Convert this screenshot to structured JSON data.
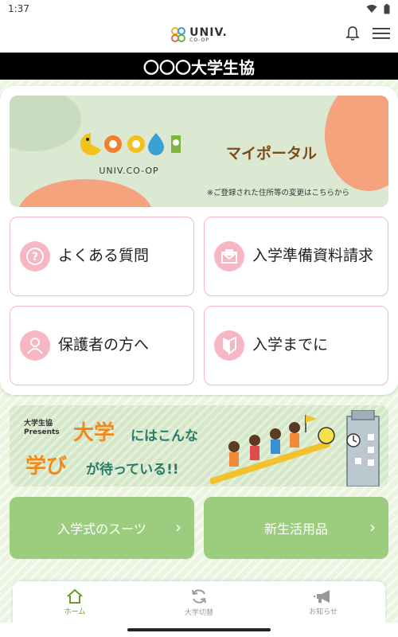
{
  "status": {
    "time": "1:37"
  },
  "header": {
    "logo_text": "UNIV.",
    "logo_sub": "CO-OP"
  },
  "title": "〇〇〇大学生協",
  "portal": {
    "logo_sub": "UNIV.CO-OP",
    "title": "マイポータル",
    "note": "※ご登録された住所等の変更はこちらから"
  },
  "tiles": [
    {
      "label": "よくある質問",
      "icon": "question-icon"
    },
    {
      "label": "入学準備資料請求",
      "icon": "mail-icon"
    },
    {
      "label": "保護者の方へ",
      "icon": "person-icon"
    },
    {
      "label": "入学までに",
      "icon": "beginner-mark-icon"
    }
  ],
  "banner": {
    "small1": "大学生協",
    "small2": "Presents",
    "big1": "大学",
    "mid1": "にはこんな",
    "big2": "学び",
    "mid2": "が待っている!!"
  },
  "buttons": [
    {
      "label": "入学式のスーツ"
    },
    {
      "label": "新生活用品"
    }
  ],
  "nav": [
    {
      "label": "ホーム",
      "icon": "home-icon",
      "active": true
    },
    {
      "label": "大学切替",
      "icon": "refresh-icon",
      "active": false
    },
    {
      "label": "お知らせ",
      "icon": "megaphone-icon",
      "active": false
    }
  ],
  "colors": {
    "accent_green": "#9ccd7f",
    "tile_border": "#f2b7c2",
    "title_bg": "#000000",
    "portal_orange": "#f4a37c"
  }
}
